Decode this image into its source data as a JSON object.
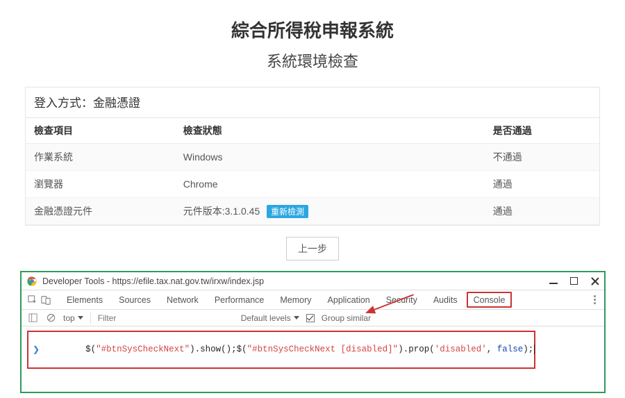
{
  "header": {
    "title": "綜合所得稅申報系統",
    "subtitle": "系統環境檢查"
  },
  "panel": {
    "login_method_label": "登入方式：金融憑證",
    "headers": {
      "item": "檢查項目",
      "status": "檢查狀態",
      "pass": "是否通過"
    },
    "rows": [
      {
        "item": "作業系統",
        "status": "Windows",
        "badge": "",
        "pass": "不通過",
        "pass_class": "pass-fail"
      },
      {
        "item": "瀏覽器",
        "status": "Chrome",
        "badge": "",
        "pass": "通過",
        "pass_class": "pass-ok"
      },
      {
        "item": "金融憑證元件",
        "status": "元件版本:3.1.0.45",
        "badge": "重新檢測",
        "pass": "通過",
        "pass_class": "pass-ok"
      }
    ],
    "prev_button": "上一步"
  },
  "devtools": {
    "title": "Developer Tools - https://efile.tax.nat.gov.tw/irxw/index.jsp",
    "tabs": [
      "Elements",
      "Sources",
      "Network",
      "Performance",
      "Memory",
      "Application",
      "Security",
      "Audits",
      "Console"
    ],
    "active_tab": "Console",
    "filterbar": {
      "context": "top",
      "filter_placeholder": "Filter",
      "levels": "Default levels",
      "group_label": "Group similar"
    },
    "console_input": {
      "p1": "$(",
      "s1": "\"#btnSysCheckNext\"",
      "p2": ").show();$(",
      "s2": "\"#btnSysCheckNext [disabled]\"",
      "p3": ").prop(",
      "s3": "'disabled'",
      "p4": ", ",
      "b1": "false",
      "p5": ");"
    }
  }
}
